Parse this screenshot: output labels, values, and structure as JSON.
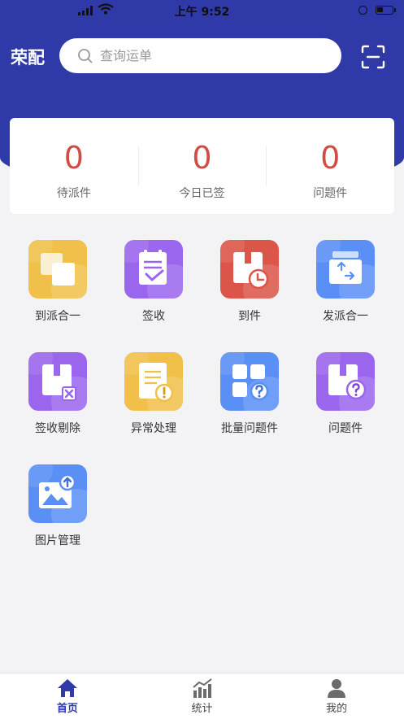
{
  "status_bar": {
    "time": "上午 9:52"
  },
  "header": {
    "title": "荣配",
    "search_placeholder": "查询运单"
  },
  "stats": [
    {
      "value": "0",
      "label": "待派件"
    },
    {
      "value": "0",
      "label": "今日已签"
    },
    {
      "value": "0",
      "label": "问题件"
    }
  ],
  "menu": [
    {
      "label": "到派合一",
      "icon": "stacked-squares-icon",
      "color": "#f0c04a"
    },
    {
      "label": "签收",
      "icon": "clipboard-check-icon",
      "color": "#9b66ee"
    },
    {
      "label": "到件",
      "icon": "package-clock-icon",
      "color": "#db5548"
    },
    {
      "label": "发派合一",
      "icon": "package-transfer-icon",
      "color": "#5a8ff5"
    },
    {
      "label": "签收剔除",
      "icon": "package-remove-icon",
      "color": "#9b66ee"
    },
    {
      "label": "异常处理",
      "icon": "document-alert-icon",
      "color": "#f0c04a"
    },
    {
      "label": "批量问题件",
      "icon": "grid-question-icon",
      "color": "#5a8ff5"
    },
    {
      "label": "问题件",
      "icon": "package-question-icon",
      "color": "#9b66ee"
    },
    {
      "label": "图片管理",
      "icon": "image-upload-icon",
      "color": "#5a8ff5"
    }
  ],
  "tabbar": [
    {
      "label": "首页",
      "icon": "home-icon",
      "active": true
    },
    {
      "label": "统计",
      "icon": "chart-icon",
      "active": false
    },
    {
      "label": "我的",
      "icon": "user-icon",
      "active": false
    }
  ],
  "colors": {
    "primary": "#2f39a8",
    "stat_value": "#cf4d43"
  }
}
